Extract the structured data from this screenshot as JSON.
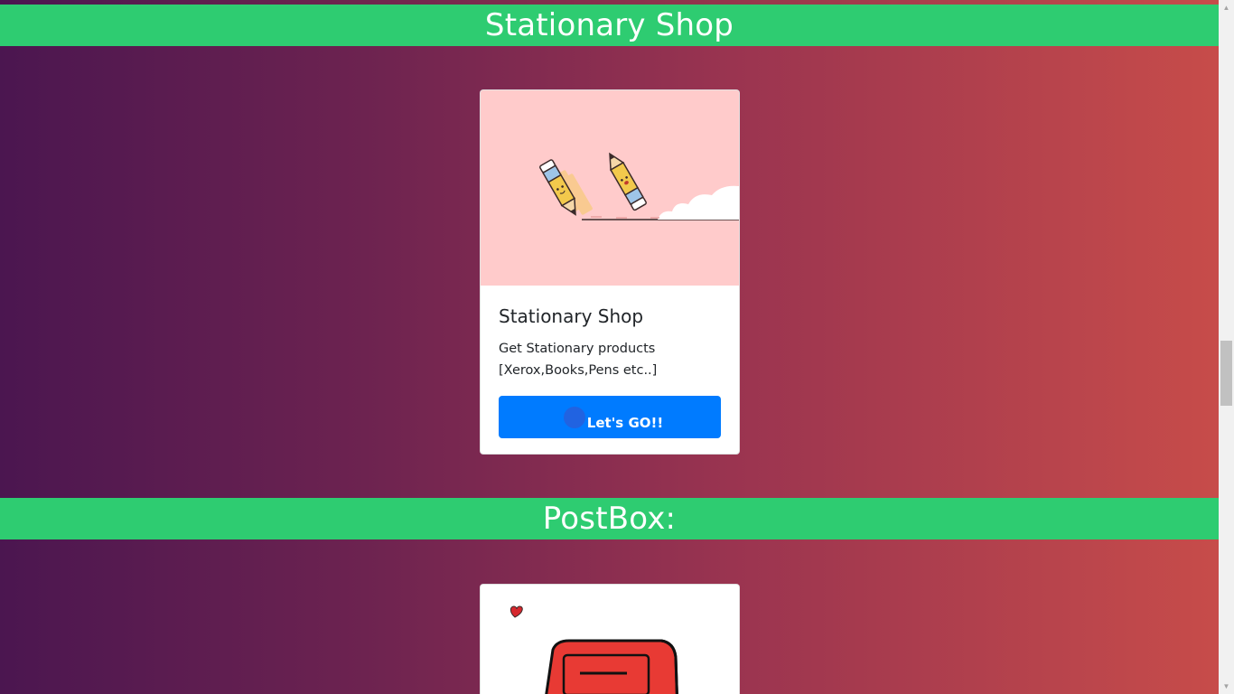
{
  "sections": [
    {
      "header": "Stationary Shop",
      "card": {
        "image_desc": "pencils illustration",
        "title": "Stationary Shop",
        "text_line1": "Get Stationary products",
        "text_line2": "[Xerox,Books,Pens etc..]",
        "button_label": "Let's GO!!"
      }
    },
    {
      "header": "PostBox:",
      "card": {
        "image_desc": "red postbox illustration"
      }
    }
  ],
  "colors": {
    "header_green": "#2ecc71",
    "button_blue": "#007bff",
    "image_bg_pink": "#ffcbcb",
    "gradient_start": "#4b1650",
    "gradient_end": "#c74c4a"
  },
  "icons": {
    "scroll_up": "▲",
    "scroll_down": "▼"
  }
}
